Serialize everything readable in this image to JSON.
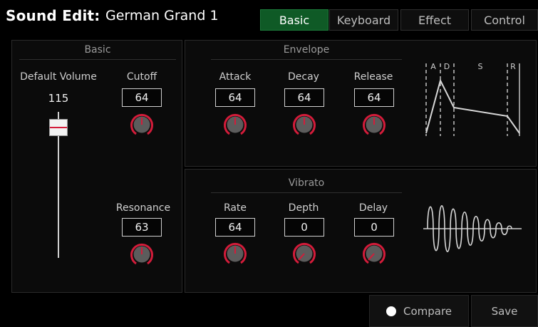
{
  "header": {
    "title": "Sound Edit:",
    "sound_name": "German Grand 1",
    "tabs": [
      {
        "label": "Basic",
        "active": true
      },
      {
        "label": "Keyboard",
        "active": false
      },
      {
        "label": "Effect",
        "active": false
      },
      {
        "label": "Control",
        "active": false
      }
    ]
  },
  "basic": {
    "title": "Basic",
    "default_volume": {
      "label": "Default Volume",
      "value": "115",
      "level_fraction": 0.9
    },
    "cutoff": {
      "label": "Cutoff",
      "value": "64"
    },
    "resonance": {
      "label": "Resonance",
      "value": "63"
    }
  },
  "envelope": {
    "title": "Envelope",
    "attack": {
      "label": "Attack",
      "value": "64"
    },
    "decay": {
      "label": "Decay",
      "value": "64"
    },
    "release": {
      "label": "Release",
      "value": "64"
    },
    "graph_labels": {
      "a": "A",
      "d": "D",
      "s": "S",
      "r": "R"
    }
  },
  "vibrato": {
    "title": "Vibrato",
    "rate": {
      "label": "Rate",
      "value": "64"
    },
    "depth": {
      "label": "Depth",
      "value": "0"
    },
    "delay": {
      "label": "Delay",
      "value": "0"
    }
  },
  "footer": {
    "compare_label": "Compare",
    "save_label": "Save"
  },
  "colors": {
    "active_tab": "#0f5a26",
    "knob_ring": "#d31c3a",
    "knob_body": "#5c5c5c"
  }
}
